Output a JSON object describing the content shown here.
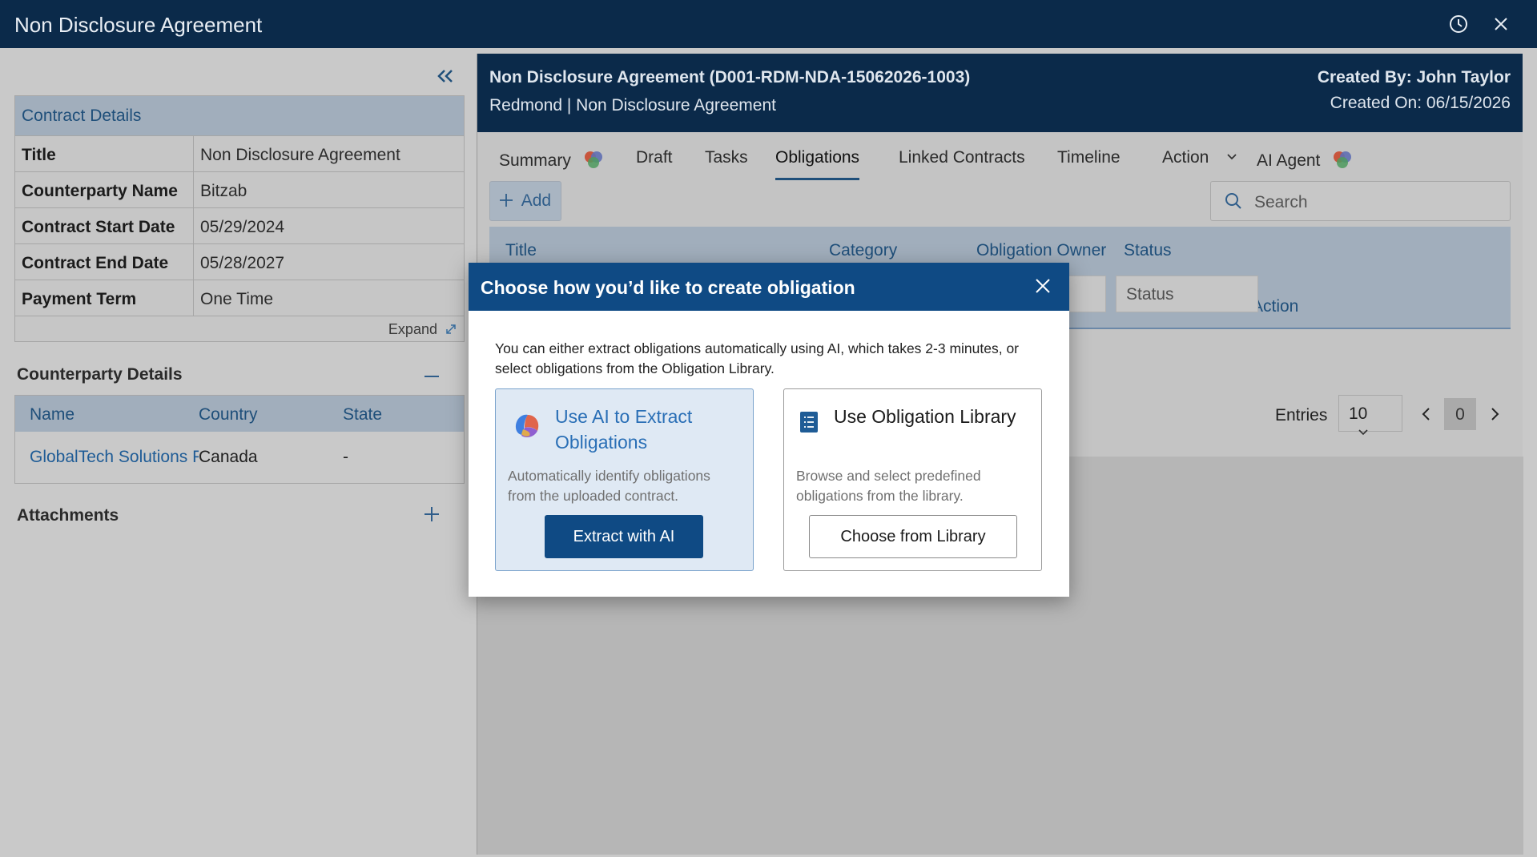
{
  "window": {
    "title": "Non Disclosure Agreement"
  },
  "contract_details": {
    "header": "Contract Details",
    "rows": [
      {
        "key": "Title",
        "value": "Non Disclosure Agreement"
      },
      {
        "key": "Counterparty Name",
        "value": "Bitzab"
      },
      {
        "key": "Contract Start Date",
        "value": "05/29/2024"
      },
      {
        "key": "Contract End Date",
        "value": "05/28/2027"
      },
      {
        "key": "Payment Term",
        "value": "One Time"
      }
    ],
    "expand_label": "Expand"
  },
  "counterparty": {
    "title": "Counterparty Details",
    "columns": [
      "Name",
      "Country",
      "State"
    ],
    "rows": [
      {
        "name": "GlobalTech Solutions P",
        "country": "Canada",
        "state": "-"
      }
    ]
  },
  "attachments": {
    "title": "Attachments"
  },
  "document": {
    "title": "Non Disclosure Agreement (D001-RDM-NDA-15062026-1003)",
    "subtitle": "Redmond | Non Disclosure Agreement",
    "created_by": "Created By: John Taylor",
    "created_on": "Created On: 06/15/2026"
  },
  "tabs": [
    "Summary",
    "Draft",
    "Tasks",
    "Obligations",
    "Linked Contracts",
    "Timeline",
    "Action",
    "AI Agent"
  ],
  "toolbar": {
    "add_label": "Add",
    "search_placeholder": "Search"
  },
  "grid": {
    "columns": [
      "Title",
      "Category",
      "Obligation Owner",
      "Status",
      "Action"
    ],
    "filters": {
      "owner": "Obligation Owner",
      "status": "Status"
    }
  },
  "pager": {
    "entries_label": "Entries",
    "entries_value": "10",
    "page": "0"
  },
  "modal": {
    "title": "Choose how you’d like to create obligation",
    "description": "You can either extract obligations automatically using AI, which takes 2-3 minutes, or select obligations from the Obligation Library.",
    "ai_option": {
      "title": "Use AI to Extract Obligations",
      "description": "Automatically identify obligations from the uploaded contract.",
      "button": "Extract with AI"
    },
    "library_option": {
      "title": "Use Obligation Library",
      "description": "Browse and select predefined obligations from the library.",
      "button": "Choose from Library"
    }
  },
  "colors": {
    "header": "#0b2a4a",
    "modal_header": "#0f4a84",
    "accent": "#1f4f7a"
  }
}
